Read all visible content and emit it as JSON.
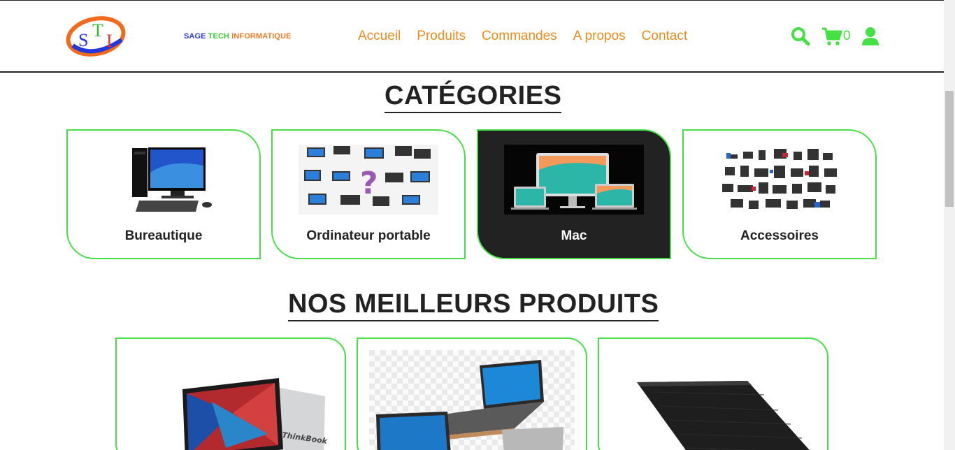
{
  "header": {
    "logo_text": "STI",
    "brand": {
      "part1": "SAGE ",
      "part2": "TECH ",
      "part3": "INFORMATIQUE"
    },
    "nav": [
      "Accueil",
      "Produits",
      "Commandes",
      "A propos",
      "Contact"
    ],
    "cart_count": "0",
    "icons": {
      "search": "search-icon",
      "cart": "cart-icon",
      "user": "user-icon"
    }
  },
  "categories": {
    "title": "CATÉGORIES",
    "items": [
      {
        "label": "Bureautique",
        "active": false
      },
      {
        "label": "Ordinateur portable",
        "active": false
      },
      {
        "label": "Mac",
        "active": true
      },
      {
        "label": "Accessoires",
        "active": false
      }
    ]
  },
  "best_products": {
    "title": "NOS MEILLEURS PRODUITS",
    "thinkbook_text": "ThinkBook"
  },
  "colors": {
    "accent_green": "#44e044",
    "nav_orange": "#ea8b1c",
    "dark": "#222222"
  }
}
